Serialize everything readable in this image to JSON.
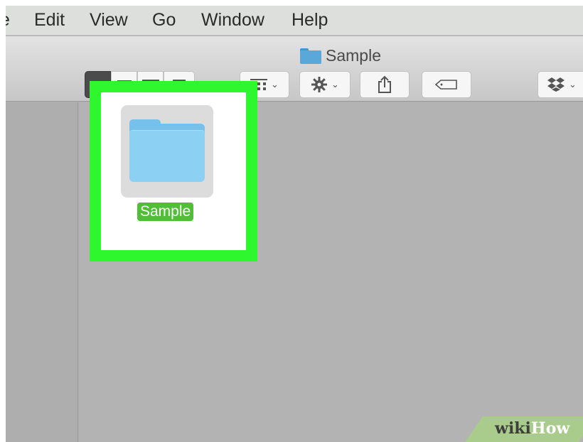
{
  "menubar": {
    "items": [
      "e",
      "Edit",
      "View",
      "Go",
      "Window",
      "Help"
    ]
  },
  "window": {
    "title": "Sample"
  },
  "toolbar": {
    "view_modes": [
      "icon-view",
      "list-view",
      "column-view",
      "cover-flow-view"
    ],
    "active_view": "icon-view",
    "buttons": [
      "arrange",
      "action",
      "share",
      "edit-tags",
      "dropbox"
    ]
  },
  "content": {
    "items": [
      {
        "name": "Sample",
        "kind": "folder",
        "selected": true
      }
    ]
  },
  "watermark": {
    "part1": "wiki",
    "part2": "How"
  },
  "colors": {
    "highlight": "#2ff72d",
    "selection_label": "#4fbf35",
    "folder": "#8cd0f4"
  }
}
